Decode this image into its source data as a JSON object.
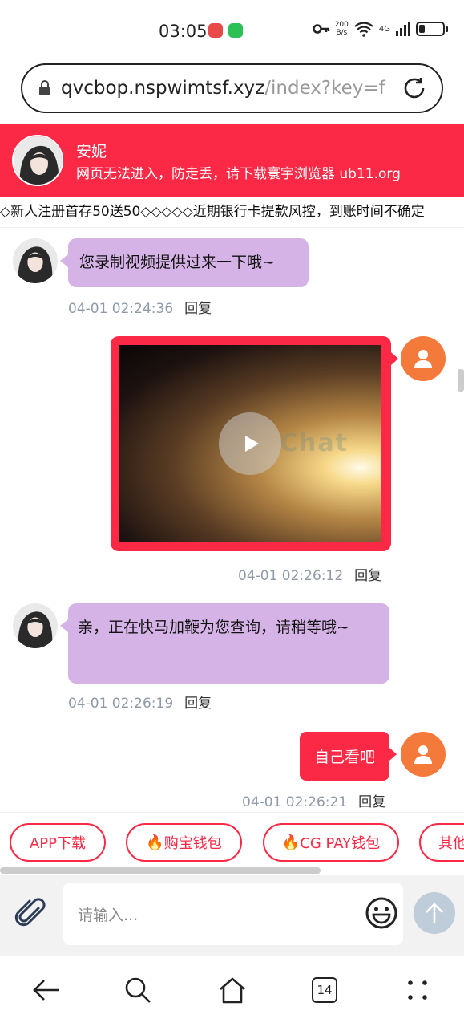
{
  "status_bar": {
    "time": "03:05",
    "net_speed_value": "200",
    "net_speed_unit": "B/s",
    "network_type": "4G",
    "battery_level": 0.25
  },
  "url_bar": {
    "host": "qvcbop.nspwimtsf.xyz",
    "path": "/index?key=f"
  },
  "header": {
    "name": "安妮",
    "subtitle": "网页无法进入，防走丢，请下载寰宇浏览器 ub11.org"
  },
  "ticker": {
    "text": "◇新人注册首存50送50◇◇◇◇◇近期银行卡提款风控，到账时间不确定"
  },
  "messages": [
    {
      "side": "left",
      "type": "text",
      "text": "您录制视频提供过来一下哦~",
      "time": "04-01 02:24:36",
      "reply": "回复"
    },
    {
      "side": "right",
      "type": "video",
      "watermark": "Chat",
      "time": "04-01 02:26:12",
      "reply": "回复"
    },
    {
      "side": "left",
      "type": "text",
      "text": "亲，正在快马加鞭为您查询，请稍等哦~",
      "time": "04-01 02:26:19",
      "reply": "回复"
    },
    {
      "side": "right",
      "type": "text",
      "text": "自己看吧",
      "time": "04-01 02:26:21",
      "reply": "回复"
    }
  ],
  "quick_actions": [
    {
      "label": "APP下载",
      "icon": ""
    },
    {
      "label": "购宝钱包",
      "icon": "🔥"
    },
    {
      "label": "CG PAY钱包",
      "icon": "🔥"
    },
    {
      "label": "其他",
      "icon": ""
    }
  ],
  "input": {
    "placeholder": "请输入..."
  },
  "nav": {
    "tab_count": "14"
  },
  "colors": {
    "brand_red": "#fb2945",
    "bubble_purple": "#d6b3e6",
    "user_avatar_orange": "#f47a3c"
  }
}
